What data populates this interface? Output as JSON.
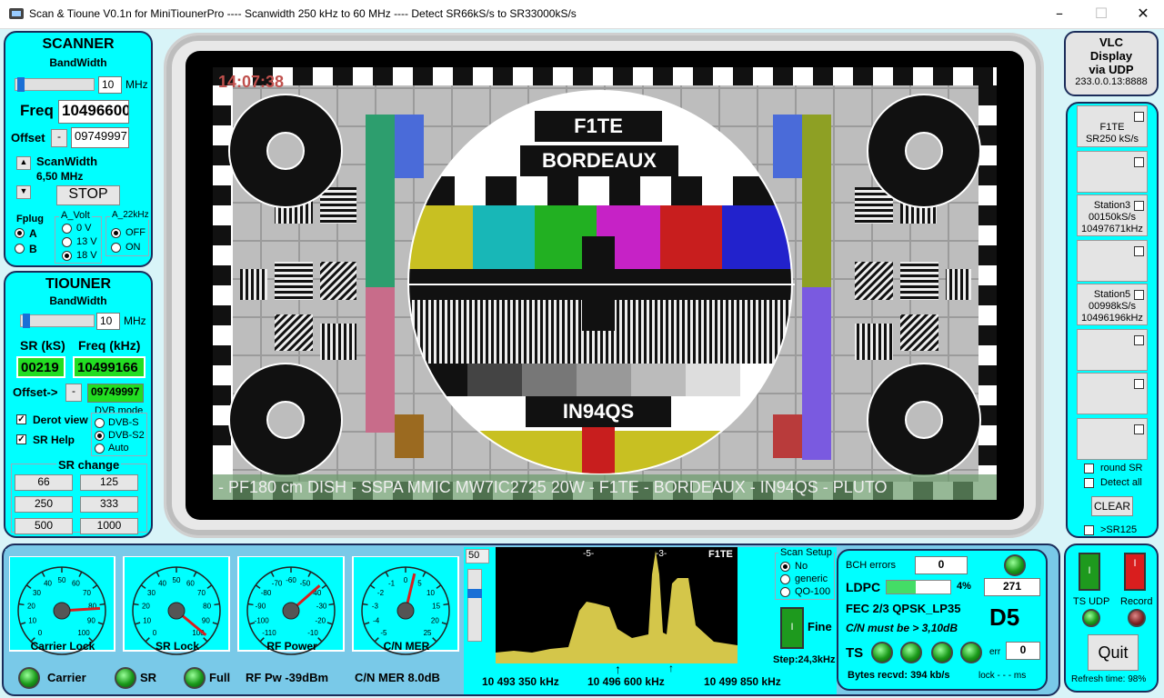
{
  "window": {
    "title": "Scan & Tioune V0.1n for MiniTiounerPro ---- Scanwidth 250 kHz to 60 MHz ---- Detect SR66kS/s to SR33000kS/s"
  },
  "scanner": {
    "title": "SCANNER",
    "bandwidth_label": "BandWidth",
    "bandwidth_value": "10",
    "mhz": "MHz",
    "freq_label": "Freq",
    "freq_value": "10496600",
    "offset_label": "Offset",
    "offset_minus": "-",
    "offset_value": "09749997",
    "scanwidth_label": "ScanWidth",
    "scanwidth_value": "6,50 MHz",
    "stop": "STOP",
    "fplug_label": "Fplug",
    "fplug_a": "A",
    "fplug_b": "B",
    "avolt_label": "A_Volt",
    "v0": "0 V",
    "v13": "13 V",
    "v18": "18 V",
    "a22_label": "A_22kHz",
    "off": "OFF",
    "on": "ON"
  },
  "tiouner": {
    "title": "TIOUNER",
    "bandwidth_label": "BandWidth",
    "bandwidth_value": "10",
    "mhz": "MHz",
    "sr_label": "SR (kS)",
    "freq_label": "Freq (kHz)",
    "sr_value": "00219",
    "freq_value": "10499166",
    "offset_label": "Offset->",
    "offset_minus": "-",
    "offset_value": "09749997",
    "derot": "Derot view",
    "srhelp": "SR Help",
    "dvb_label": "DVB mode",
    "dvbs": "DVB-S",
    "dvbs2": "DVB-S2",
    "auto": "Auto",
    "srchange_label": "SR change",
    "sr_buttons": [
      "66",
      "125",
      "250",
      "333",
      "500",
      "1000"
    ]
  },
  "video": {
    "time": "14:07:38",
    "title_top": "F1TE",
    "title_city": "BORDEAUX",
    "locator": "IN94QS",
    "ticker": "- PF180 cm DISH - SSPA MMIC MW7IC2725 20W - F1TE - BORDEAUX - IN94QS - PLUTO"
  },
  "vlc": {
    "line1": "VLC",
    "line2": "Display",
    "line3": "via UDP",
    "addr": "233.0.0.13:8888"
  },
  "stations": [
    {
      "l1": "F1TE",
      "l2": "SR250 kS/s",
      "l3": ""
    },
    {
      "l1": "",
      "l2": "",
      "l3": ""
    },
    {
      "l1": "Station3",
      "l2": "00150kS/s",
      "l3": "10497671kHz"
    },
    {
      "l1": "",
      "l2": "",
      "l3": ""
    },
    {
      "l1": "Station5",
      "l2": "00998kS/s",
      "l3": "10496196kHz"
    },
    {
      "l1": "",
      "l2": "",
      "l3": ""
    },
    {
      "l1": "",
      "l2": "",
      "l3": ""
    },
    {
      "l1": "",
      "l2": "",
      "l3": ""
    }
  ],
  "right_opts": {
    "round_sr": "round SR",
    "detect_all": "Detect all",
    "clear": "CLEAR",
    "sr125": ">SR125"
  },
  "gauges": [
    {
      "label": "Carrier Lock",
      "ticks": [
        "0",
        "10",
        "20",
        "30",
        "40",
        "50",
        "60",
        "70",
        "80",
        "90",
        "100"
      ],
      "needle": 0.82
    },
    {
      "label": "SR Lock",
      "ticks": [
        "0",
        "10",
        "20",
        "30",
        "40",
        "50",
        "60",
        "70",
        "80",
        "90",
        "100"
      ],
      "needle": 0.98
    },
    {
      "label": "RF Power",
      "ticks": [
        "-110",
        "-100",
        "-90",
        "-80",
        "-70",
        "-60",
        "-50",
        "-40",
        "-30",
        "-20",
        "-10"
      ],
      "needle": 0.68
    },
    {
      "label": "C/N MER",
      "ticks": [
        "-5",
        "-4",
        "-3",
        "-2",
        "-1",
        "0",
        "5",
        "10",
        "15",
        "20",
        "25"
      ],
      "needle": 0.55
    }
  ],
  "status": {
    "carrier": "Carrier",
    "sr": "SR",
    "full": "Full",
    "rfpw": "RF Pw -39dBm",
    "cnmer": "C/N MER 8.0dB"
  },
  "spectrum": {
    "gain": "50",
    "marker1": "-5-",
    "marker2": "-3-",
    "callsign": "F1TE",
    "freq_left": "10 493 350 kHz",
    "freq_mid": "10 496 600 kHz",
    "freq_right": "10 499 850 kHz",
    "scan_setup": "Scan Setup",
    "no": "No",
    "generic": "generic",
    "qo100": "QO-100",
    "fine": "Fine",
    "step": "Step:24,3kHz"
  },
  "decoder": {
    "bch_label": "BCH errors",
    "bch_value": "0",
    "ldpc_label": "LDPC",
    "ldpc_pct": "4%",
    "ldpc_value": "271",
    "fec": "FEC  2/3 QPSK_LP35",
    "cn_must": "C/N must be > 3,10dB",
    "d5": "D5",
    "ts_label": "TS",
    "err_label": "err",
    "err_value": "0",
    "bytes": "Bytes recvd: 394 kb/s",
    "lock": "lock - - - ms",
    "ldpc_fill": 0.45
  },
  "controls": {
    "ts_udp": "TS UDP",
    "record": "Record",
    "quit": "Quit",
    "refresh": "Refresh time:  98%"
  },
  "colors": {
    "cyan": "#00ffff",
    "navy": "#1b2c5a",
    "green": "#22dd22",
    "spectrum": "#d4c64a"
  }
}
